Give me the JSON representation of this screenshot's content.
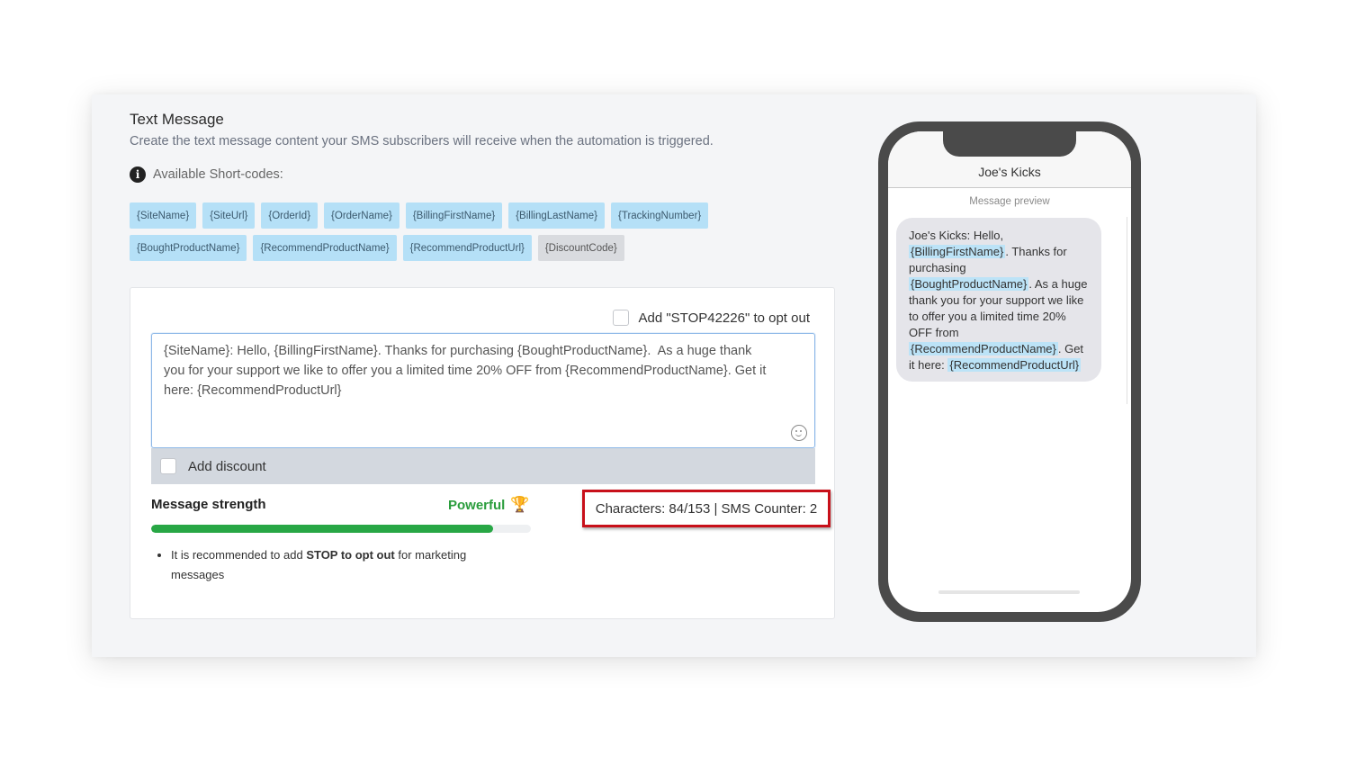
{
  "section": {
    "title": "Text Message",
    "subtitle": "Create the text message content your SMS subscribers will receive when the automation is triggered.",
    "shortcodes_label": "Available Short-codes:"
  },
  "shortcodes": {
    "row1": [
      "{SiteName}",
      "{SiteUrl}",
      "{OrderId}",
      "{OrderName}",
      "{BillingFirstName}",
      "{BillingLastName}",
      "{TrackingNumber}"
    ],
    "row2": [
      "{BoughtProductName}",
      "{RecommendProductName}",
      "{RecommendProductUrl}",
      "{DiscountCode}"
    ]
  },
  "editor": {
    "optout_label": "Add \"STOP42226\" to opt out",
    "message": "{SiteName}: Hello, {BillingFirstName}. Thanks for purchasing {BoughtProductName}.  As a huge thank you for your support we like to offer you a limited time 20% OFF from {RecommendProductName}. Get it here: {RecommendProductUrl}",
    "discount_label": "Add discount"
  },
  "strength": {
    "label": "Message strength",
    "value": "Powerful",
    "progress": 0.9,
    "color": "#28a745"
  },
  "counter": {
    "text": "Characters: 84/153 | SMS Counter: 2"
  },
  "tips": {
    "prefix": "It is recommended to add ",
    "bold": "STOP to opt out",
    "suffix": " for marketing messages"
  },
  "phone": {
    "contact": "Joe's Kicks",
    "preview_label": "Message preview",
    "segments": {
      "s1": "Joe's Kicks: Hello, ",
      "h1": "{BillingFirstName}",
      "s2": ". Thanks for purchasing ",
      "h2": "{BoughtProductName}",
      "s3": ". As a huge thank you for your support we like to offer you a limited time 20% OFF from ",
      "h3": "{RecommendProductName}",
      "s4": ". Get it here: ",
      "h4": "{RecommendProductUrl}"
    }
  }
}
